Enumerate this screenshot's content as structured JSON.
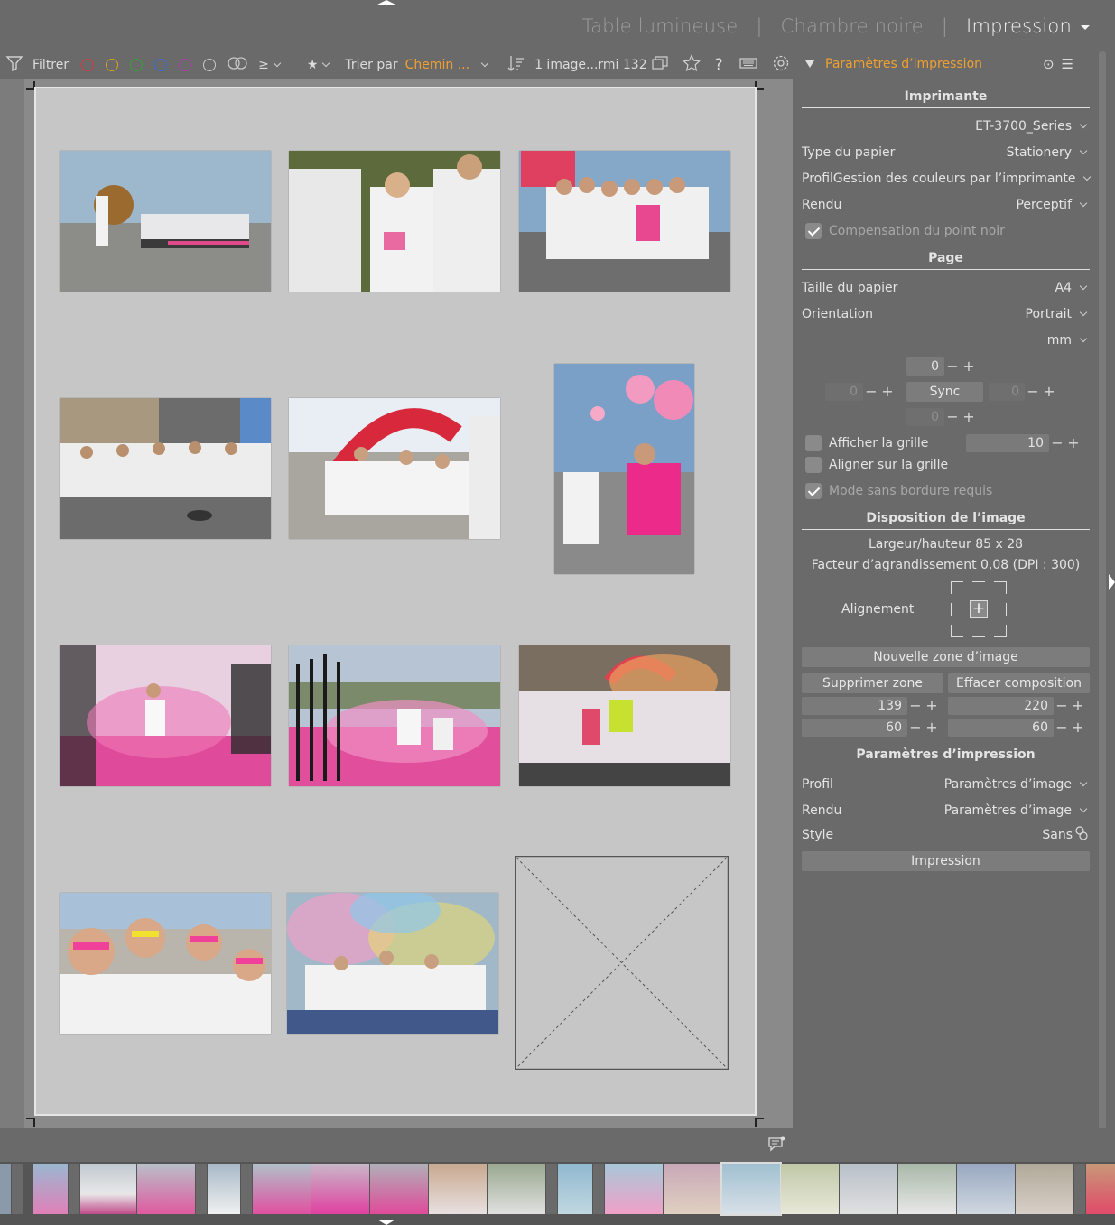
{
  "header": {
    "views": [
      "Table lumineuse",
      "Chambre noire",
      "Impression"
    ],
    "active_view": "Impression"
  },
  "toolbar": {
    "filter_label": "Filtrer",
    "color_labels": [
      "#d43a3a",
      "#d9a21f",
      "#35a235",
      "#3a6bd0",
      "#b03ab0"
    ],
    "rating_op": "≥",
    "rating_value": "★",
    "sort_label": "Trier par",
    "sort_value": "Chemin ...",
    "count_text": "1 image...rmi 132",
    "icons": [
      "filter-icon",
      "star-icon",
      "help-icon",
      "keyboard-icon",
      "gear-icon"
    ]
  },
  "panel": {
    "title": "Paramètres d’impression",
    "printer_section": "Imprimante",
    "printer_name": "ET-3700_Series",
    "paper_type_label": "Type du papier",
    "paper_type_value": "Stationery",
    "profile_label": "Profil",
    "profile_value": "Gestion des couleurs par l’imprimante",
    "intent_label": "Rendu",
    "intent_value": "Perceptif",
    "bpc_label": "Compensation du point noir",
    "page_section": "Page",
    "paper_size_label": "Taille du papier",
    "paper_size_value": "A4",
    "orientation_label": "Orientation",
    "orientation_value": "Portrait",
    "unit_value": "mm",
    "margin_top": "0",
    "margin_left": "0",
    "margin_right": "0",
    "margin_bottom": "0",
    "sync_label": "Sync",
    "show_grid_label": "Afficher la grille",
    "grid_value": "10",
    "snap_grid_label": "Aligner sur la grille",
    "borderless_label": "Mode sans bordure requis",
    "layout_section": "Disposition de l’image",
    "size_text": "Largeur/hauteur 85 x 28",
    "scale_text": "Facteur d’agrandissement 0,08 (DPI : 300)",
    "alignment_label": "Alignement",
    "new_area_label": "Nouvelle zone d’image",
    "delete_area_label": "Supprimer zone image",
    "clear_layout_label": "Effacer composition",
    "area_x": "139",
    "area_y": "220",
    "area_w": "60",
    "area_h": "60",
    "print_section": "Paramètres d’impression",
    "print_profile_label": "Profil",
    "print_profile_value": "Paramètres d’image",
    "print_intent_label": "Rendu",
    "print_intent_value": "Paramètres d’image",
    "style_label": "Style",
    "style_value": "Sans",
    "print_button": "Impression"
  }
}
